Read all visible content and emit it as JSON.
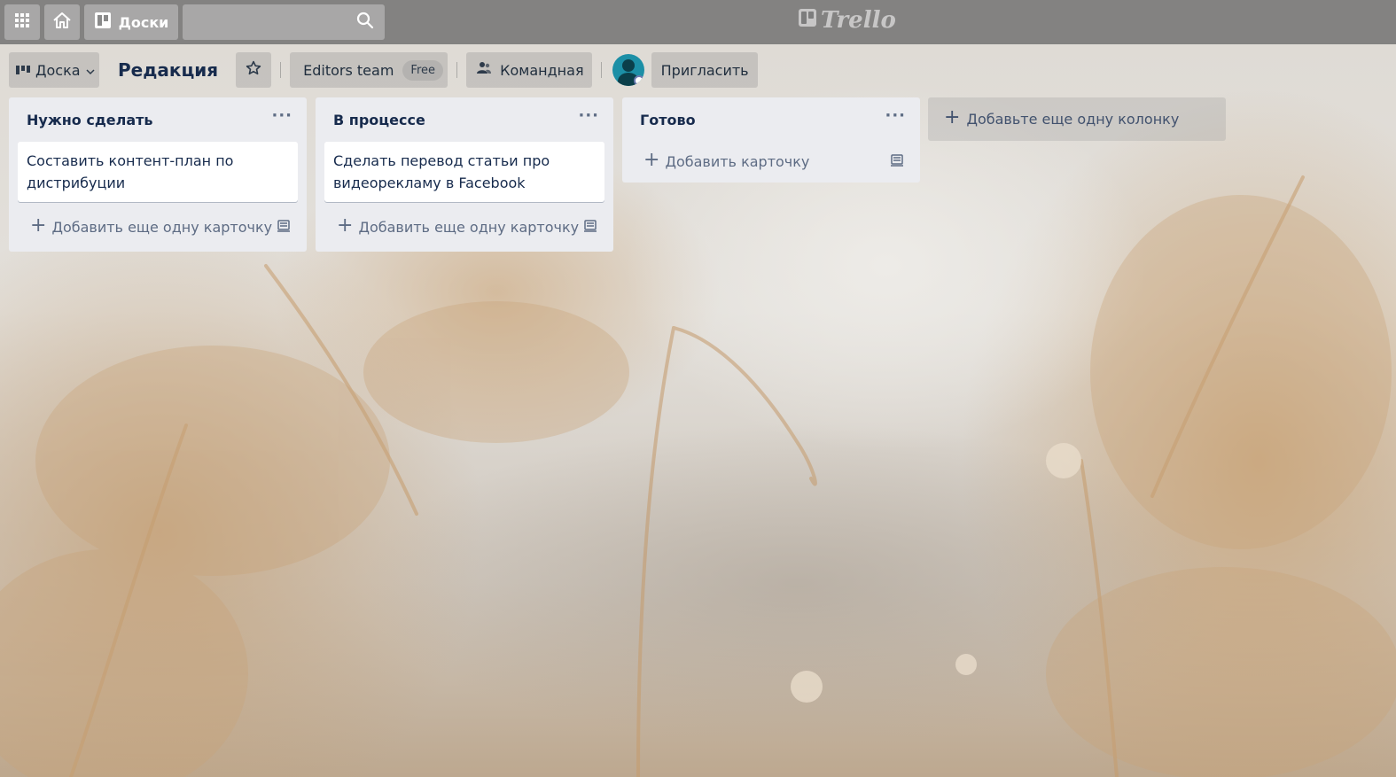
{
  "header": {
    "apps_icon": "grid-icon",
    "home_icon": "home-icon",
    "boards_label": "Доски",
    "search_value": "",
    "search_icon": "search-icon",
    "logo_text": "Trello"
  },
  "board": {
    "view_label": "Доска",
    "title": "Редакция",
    "team_name": "Editors team",
    "team_plan": "Free",
    "visibility_label": "Командная",
    "invite_label": "Пригласить"
  },
  "lists": [
    {
      "title": "Нужно сделать",
      "cards": [
        "Составить контент-план по дистрибуции"
      ],
      "add_label": "Добавить еще одну карточку"
    },
    {
      "title": "В процессе",
      "cards": [
        "Сделать перевод статьи про видеорекламу в Facebook"
      ],
      "add_label": "Добавить еще одну карточку"
    },
    {
      "title": "Готово",
      "cards": [],
      "add_label": "Добавить карточку"
    }
  ],
  "add_list_label": "Добавьте еще одну колонку",
  "colors": {
    "topbar": "#696969",
    "list_bg": "#ebecf0",
    "text_dark": "#172b4d",
    "text_muted": "#5e6c84",
    "avatar": "#1c8fa6"
  }
}
